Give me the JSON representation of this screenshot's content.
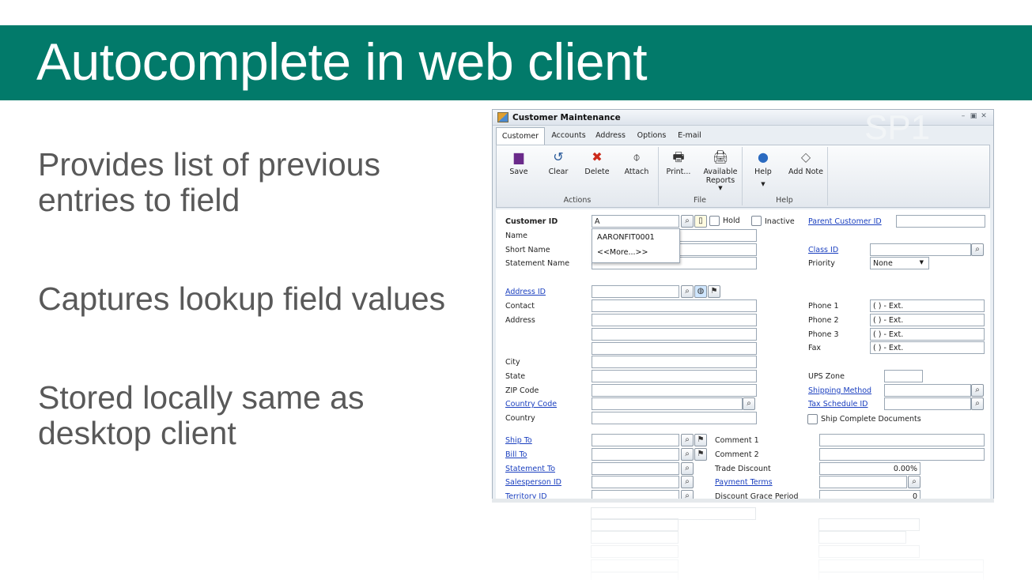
{
  "slide": {
    "title": "Autocomplete in web client",
    "bullets": [
      "Provides list of previous entries to field",
      "Captures lookup field values",
      "Stored locally same as desktop client"
    ]
  },
  "window": {
    "title": "Customer Maintenance",
    "watermark": "SP1",
    "tabs": [
      "Customer",
      "Accounts",
      "Address",
      "Options",
      "E-mail"
    ],
    "ribbon": {
      "buttons": [
        "Save",
        "Clear",
        "Delete",
        "Attach",
        "Print...",
        "Available Reports",
        "Help",
        "Add Note"
      ],
      "groups": [
        "Actions",
        "File",
        "Help"
      ]
    },
    "form": {
      "customer_id_label": "Customer ID",
      "customer_id_value": "A",
      "hold_label": "Hold",
      "inactive_label": "Inactive",
      "parent_customer_id_label": "Parent Customer ID",
      "name_label": "Name",
      "short_name_label": "Short Name",
      "statement_name_label": "Statement Name",
      "class_id_label": "Class ID",
      "priority_label": "Priority",
      "priority_value": "None",
      "address_id_label": "Address ID",
      "contact_label": "Contact",
      "address_label": "Address",
      "city_label": "City",
      "state_label": "State",
      "zip_label": "ZIP Code",
      "country_code_label": "Country Code",
      "country_label": "Country",
      "phone1_label": "Phone 1",
      "phone2_label": "Phone 2",
      "phone3_label": "Phone 3",
      "fax_label": "Fax",
      "phone_mask": "(  )   -     Ext.",
      "ups_zone_label": "UPS Zone",
      "shipping_method_label": "Shipping Method",
      "tax_schedule_label": "Tax Schedule ID",
      "ship_complete_label": "Ship Complete Documents",
      "ship_to_label": "Ship To",
      "bill_to_label": "Bill To",
      "statement_to_label": "Statement To",
      "salesperson_label": "Salesperson ID",
      "territory_label": "Territory ID",
      "comment1_label": "Comment 1",
      "comment2_label": "Comment 2",
      "trade_discount_label": "Trade Discount",
      "trade_discount_value": "0.00%",
      "payment_terms_label": "Payment Terms",
      "discount_grace_label": "Discount Grace Period",
      "discount_grace_value": "0"
    },
    "autocomplete": {
      "items": [
        "AARONFIT0001",
        "<<More...>>"
      ]
    }
  },
  "colors": {
    "banner": "#027a6a",
    "bullet_text": "#595959",
    "link": "#1a3fbf"
  },
  "icons": [
    "save-icon",
    "clear-icon",
    "delete-icon",
    "attach-icon",
    "print-icon",
    "reports-icon",
    "help-icon",
    "note-icon",
    "lookup-icon"
  ]
}
